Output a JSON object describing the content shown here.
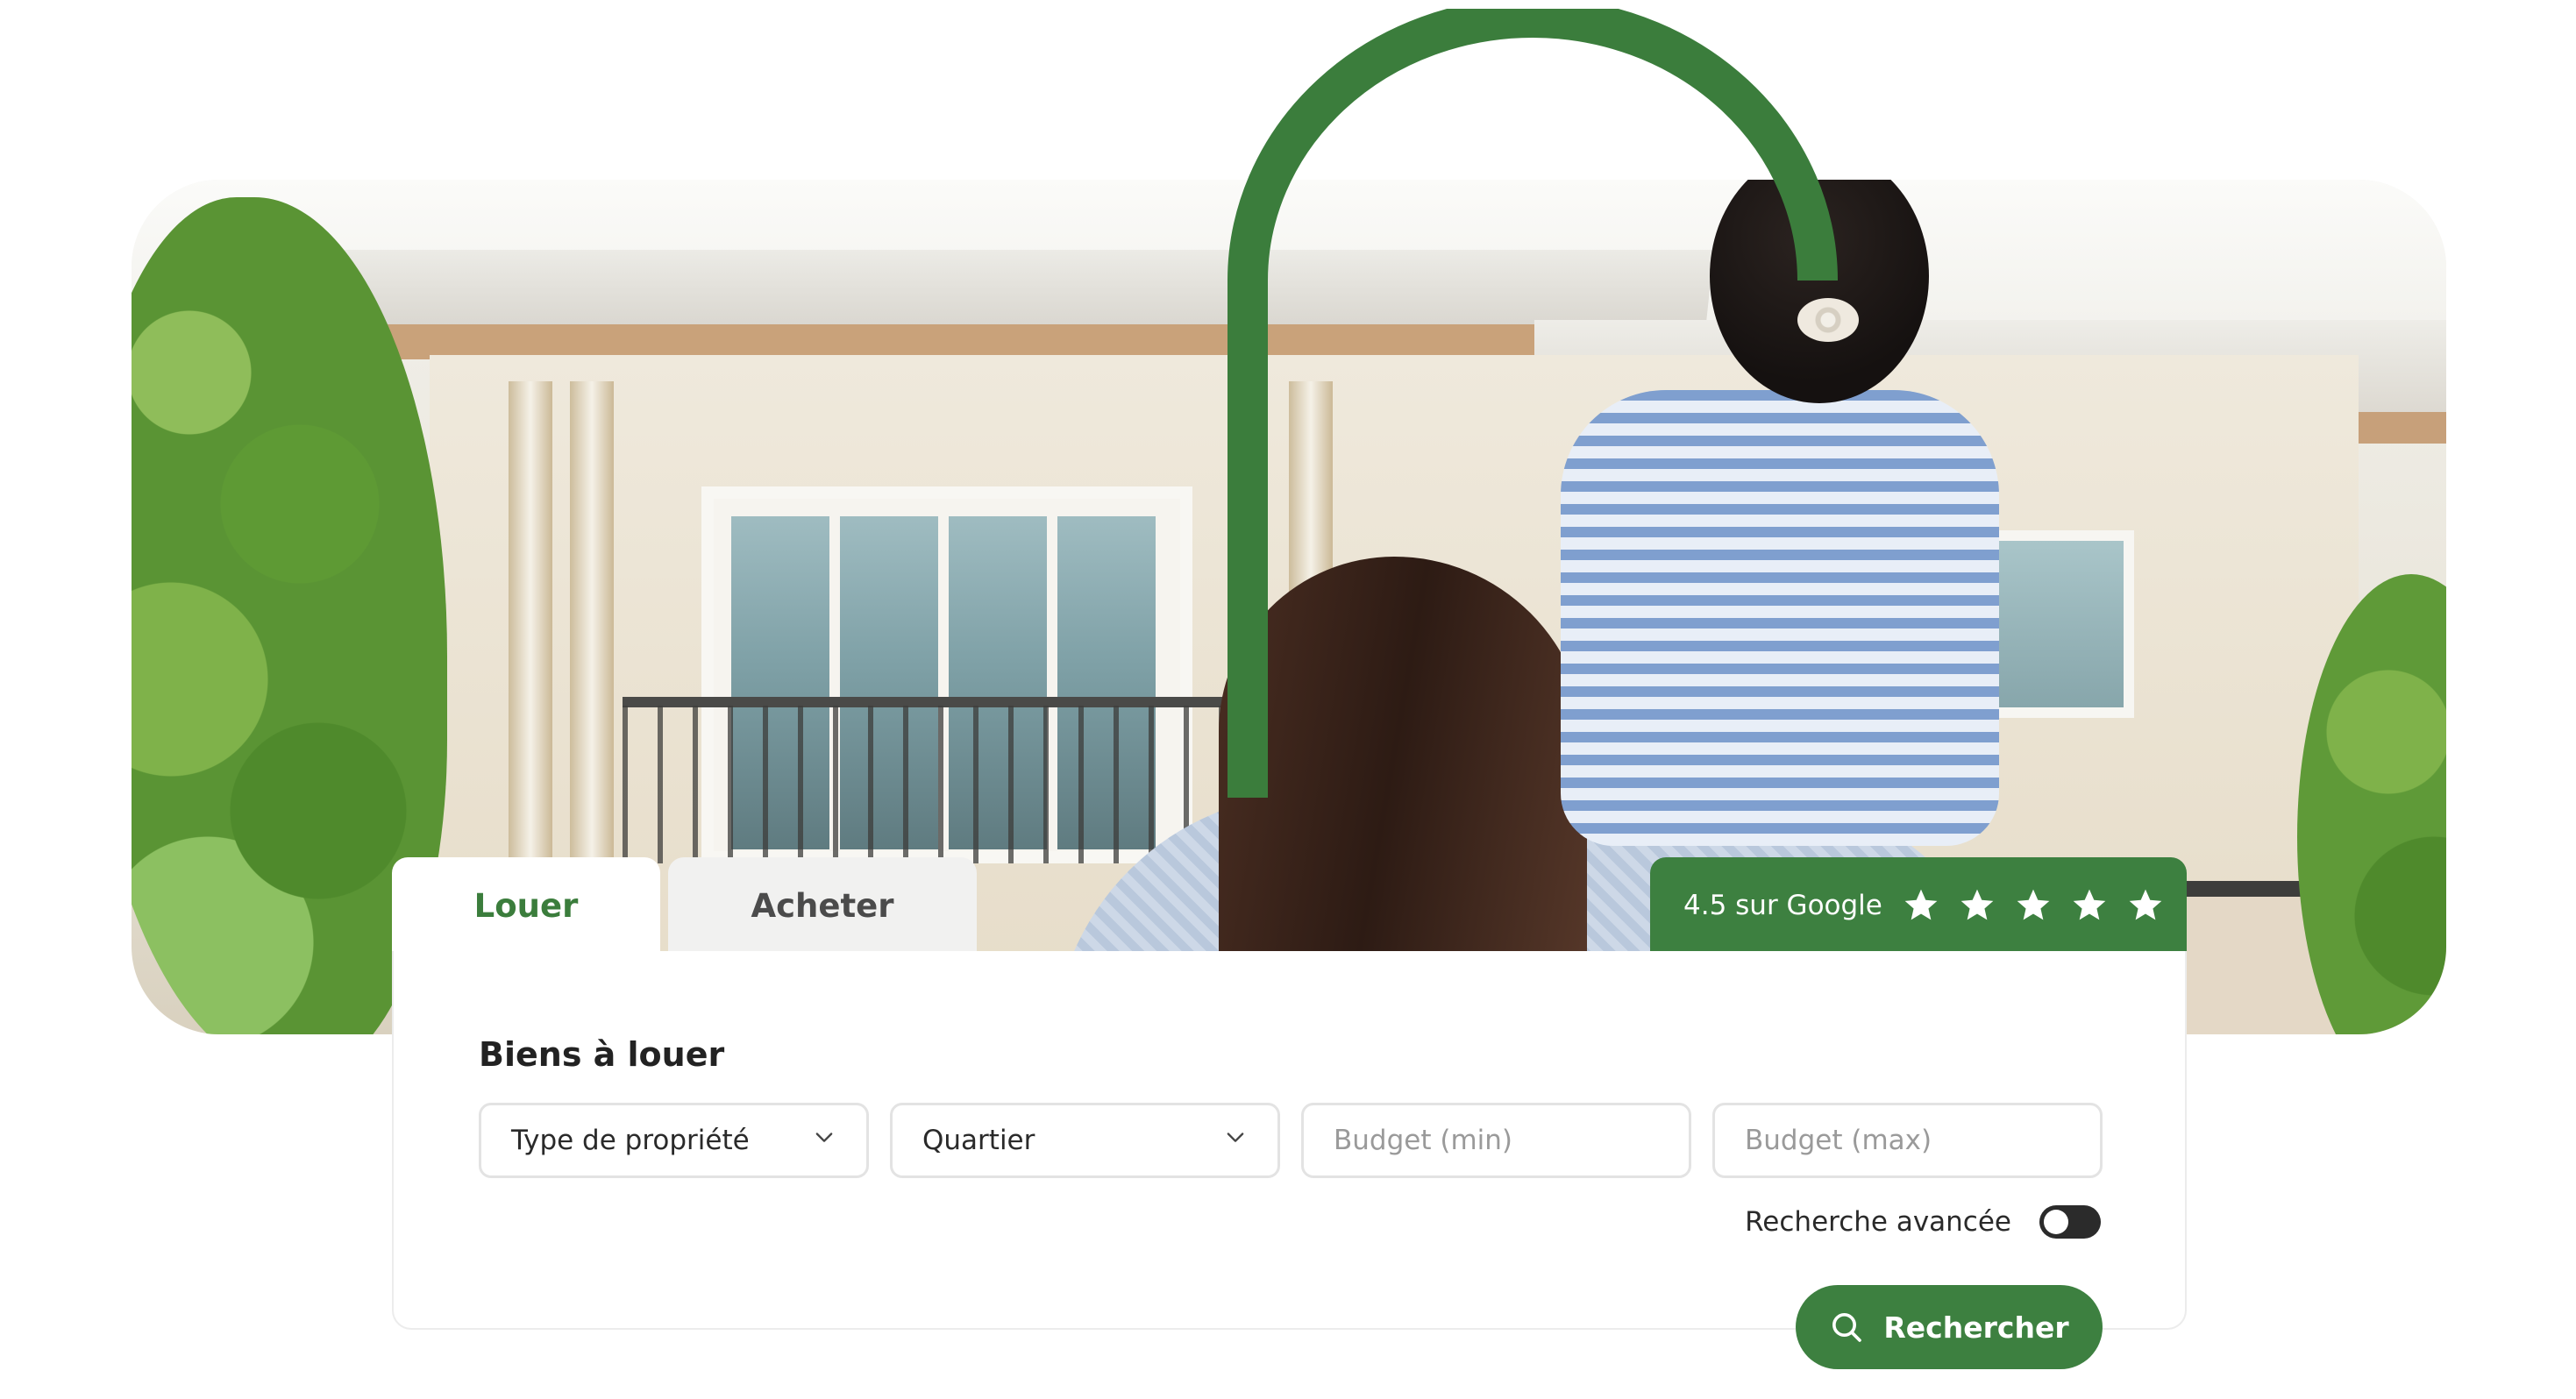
{
  "tabs": [
    {
      "label": "Louer",
      "active": true
    },
    {
      "label": "Acheter",
      "active": false
    }
  ],
  "rating": {
    "text": "4.5 sur Google",
    "value": 4.5,
    "stars_shown": 5
  },
  "search": {
    "title": "Biens à louer",
    "property_type": {
      "value": "Type de propriété",
      "icon": "chevron-down-icon"
    },
    "neighborhood": {
      "value": "Quartier",
      "icon": "chevron-down-icon"
    },
    "budget_min_placeholder": "Budget (min)",
    "budget_max_placeholder": "Budget (max)",
    "advanced_label": "Recherche avancée",
    "advanced_enabled": false,
    "submit_label": "Rechercher",
    "submit_icon": "search-icon"
  },
  "colors": {
    "brand_green": "#3d8040",
    "text_dark": "#222222",
    "placeholder": "#9a9a9a"
  }
}
